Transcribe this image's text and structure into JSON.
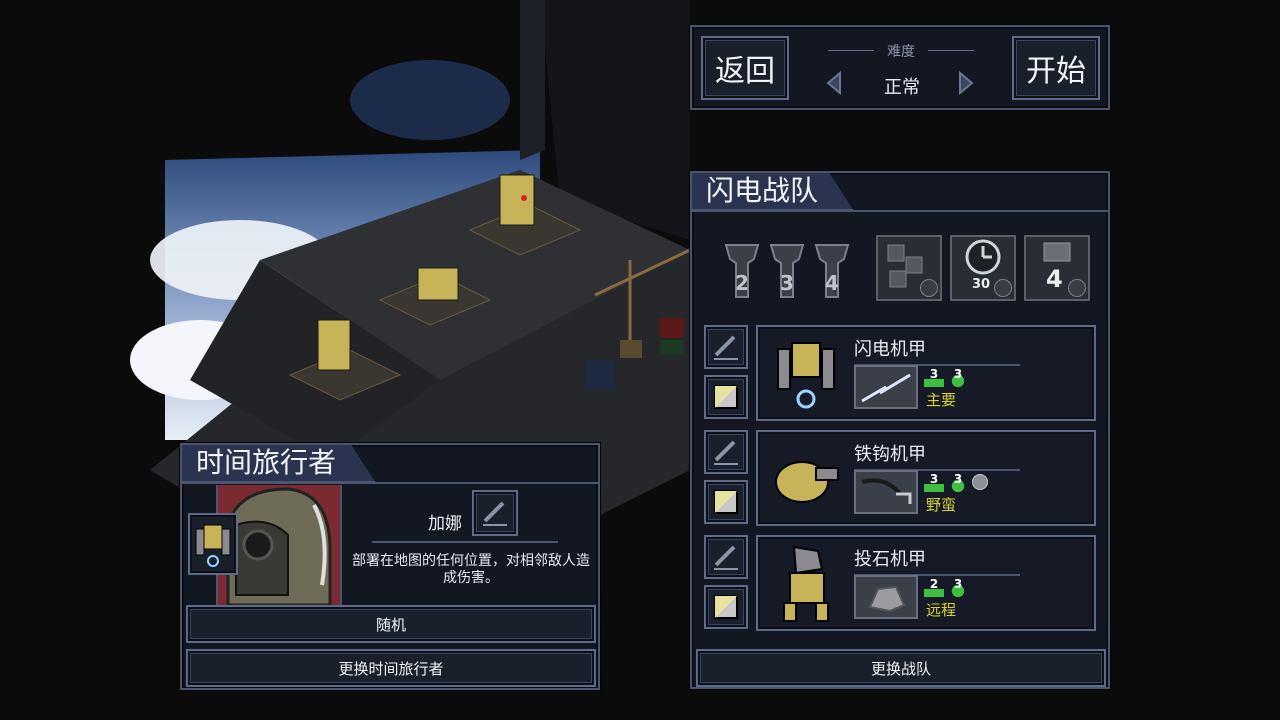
{
  "top_panel": {
    "back_label": "返回",
    "start_label": "开始",
    "difficulty_title": "难度",
    "difficulty_value": "正常"
  },
  "squad": {
    "title": "闪电战队",
    "rank_icons": [
      "2",
      "3",
      "4"
    ],
    "abilities": [
      {
        "icon": "map-grid-icon"
      },
      {
        "icon": "timer-icon",
        "value": "30"
      },
      {
        "icon": "mech-count-icon",
        "value": "4"
      }
    ],
    "mechs": [
      {
        "name": "闪电机甲",
        "move": "3",
        "repair": "3",
        "class": "主要",
        "weapon_icon": "lightning-whip-icon"
      },
      {
        "name": "铁钩机甲",
        "move": "3",
        "repair": "3",
        "class": "野蛮",
        "weapon_icon": "grappling-hook-icon",
        "has_extra": true
      },
      {
        "name": "投石机甲",
        "move": "2",
        "repair": "3",
        "class": "远程",
        "weapon_icon": "rock-launcher-icon"
      }
    ],
    "change_label": "更换战队"
  },
  "time_traveler": {
    "title": "时间旅行者",
    "name": "加娜",
    "description": "部署在地图的任何位置，对相邻敌人造成伤害。",
    "random_label": "随机",
    "change_label": "更换时间旅行者"
  },
  "colors": {
    "panel_bg": "#131722",
    "panel_border": "#4a5670",
    "tab_bg": "#2a3350",
    "class_text": "#d8d42a",
    "stat_green": "#3fbf3f"
  }
}
